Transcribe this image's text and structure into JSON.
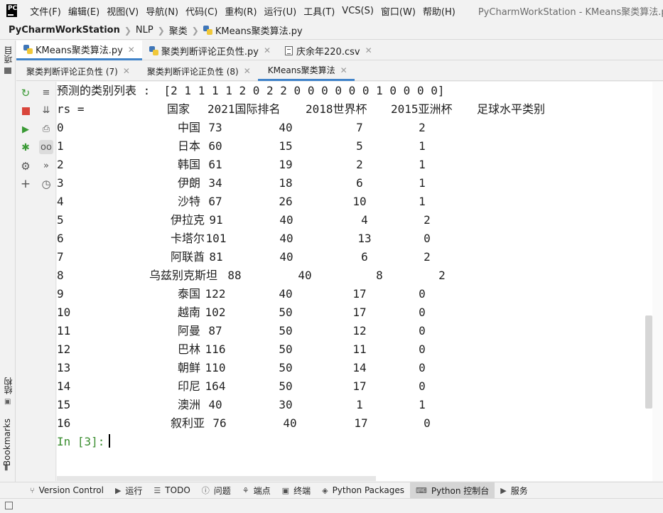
{
  "menubar": {
    "items": [
      "文件(F)",
      "编辑(E)",
      "视图(V)",
      "导航(N)",
      "代码(C)",
      "重构(R)",
      "运行(U)",
      "工具(T)",
      "VCS(S)",
      "窗口(W)",
      "帮助(H)"
    ],
    "window_title": "PyCharmWorkStation - KMeans聚类算法.py",
    "logo_text": "PC"
  },
  "breadcrumb": {
    "project": "PyCharmWorkStation",
    "folder1": "NLP",
    "folder2": "聚类",
    "file": "KMeans聚类算法.py"
  },
  "left_strip": {
    "project_label": "项目",
    "structure_label": "结构",
    "bookmarks_label": "Bookmarks"
  },
  "editor_tabs": [
    "KMeans聚类算法.py",
    "聚类判断评论正负性.py",
    "庆余年220.csv"
  ],
  "console_tabs": [
    "聚类判断评论正负性 (7)",
    "聚类判断评论正负性 (8)",
    "KMeans聚类算法"
  ],
  "console": {
    "predicted_line": "预测的类别列表 :  [2 1 1 1 1 2 0 2 2 0 0 0 0 0 0 1 0 0 0 0]",
    "rs_label": "rs =",
    "headers": [
      "国家",
      "2021国际排名",
      "2018世界杯",
      "2015亚洲杯",
      "足球水平类别"
    ],
    "rows": [
      [
        "0",
        "中国",
        "73",
        "40",
        "7",
        "2"
      ],
      [
        "1",
        "日本",
        "60",
        "15",
        "5",
        "1"
      ],
      [
        "2",
        "韩国",
        "61",
        "19",
        "2",
        "1"
      ],
      [
        "3",
        "伊朗",
        "34",
        "18",
        "6",
        "1"
      ],
      [
        "4",
        "沙特",
        "67",
        "26",
        "10",
        "1"
      ],
      [
        "5",
        "伊拉克",
        "91",
        "40",
        "4",
        "2"
      ],
      [
        "6",
        "卡塔尔",
        "101",
        "40",
        "13",
        "0"
      ],
      [
        "7",
        "阿联酋",
        "81",
        "40",
        "6",
        "2"
      ],
      [
        "8",
        "乌兹别克斯坦",
        "88",
        "40",
        "8",
        "2"
      ],
      [
        "9",
        "泰国",
        "122",
        "40",
        "17",
        "0"
      ],
      [
        "10",
        "越南",
        "102",
        "50",
        "17",
        "0"
      ],
      [
        "11",
        "阿曼",
        "87",
        "50",
        "12",
        "0"
      ],
      [
        "12",
        "巴林",
        "116",
        "50",
        "11",
        "0"
      ],
      [
        "13",
        "朝鲜",
        "110",
        "50",
        "14",
        "0"
      ],
      [
        "14",
        "印尼",
        "164",
        "50",
        "17",
        "0"
      ],
      [
        "15",
        "澳洲",
        "40",
        "30",
        "1",
        "1"
      ],
      [
        "16",
        "叙利亚",
        "76",
        "40",
        "17",
        "0"
      ]
    ],
    "prompt": "In [3]:"
  },
  "bottom_tools": [
    "Version Control",
    "运行",
    "TODO",
    "问题",
    "端点",
    "终端",
    "Python Packages",
    "Python 控制台",
    "服务"
  ]
}
